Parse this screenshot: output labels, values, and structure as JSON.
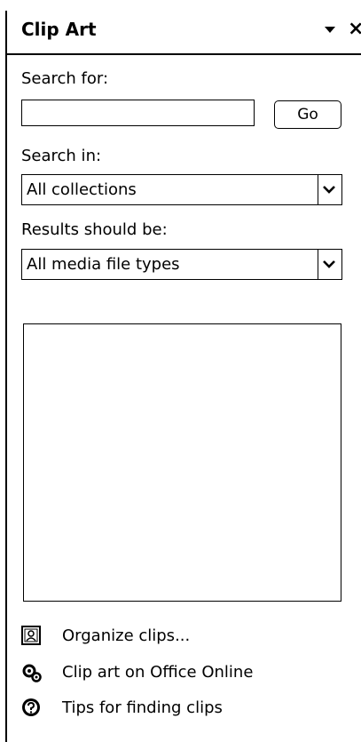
{
  "pane": {
    "title": "Clip Art",
    "menu_icon": "dropdown-triangle-icon",
    "close_icon": "close-icon"
  },
  "search": {
    "label": "Search for:",
    "value": "",
    "go_label": "Go"
  },
  "search_in": {
    "label": "Search in:",
    "selected": "All collections"
  },
  "results_type": {
    "label": "Results should be:",
    "selected": "All media file types"
  },
  "links": [
    {
      "label": "Organize clips...",
      "icon": "organize-clips-icon"
    },
    {
      "label": "Clip art on Office Online",
      "icon": "office-online-icon"
    },
    {
      "label": "Tips for finding clips",
      "icon": "help-icon"
    }
  ]
}
